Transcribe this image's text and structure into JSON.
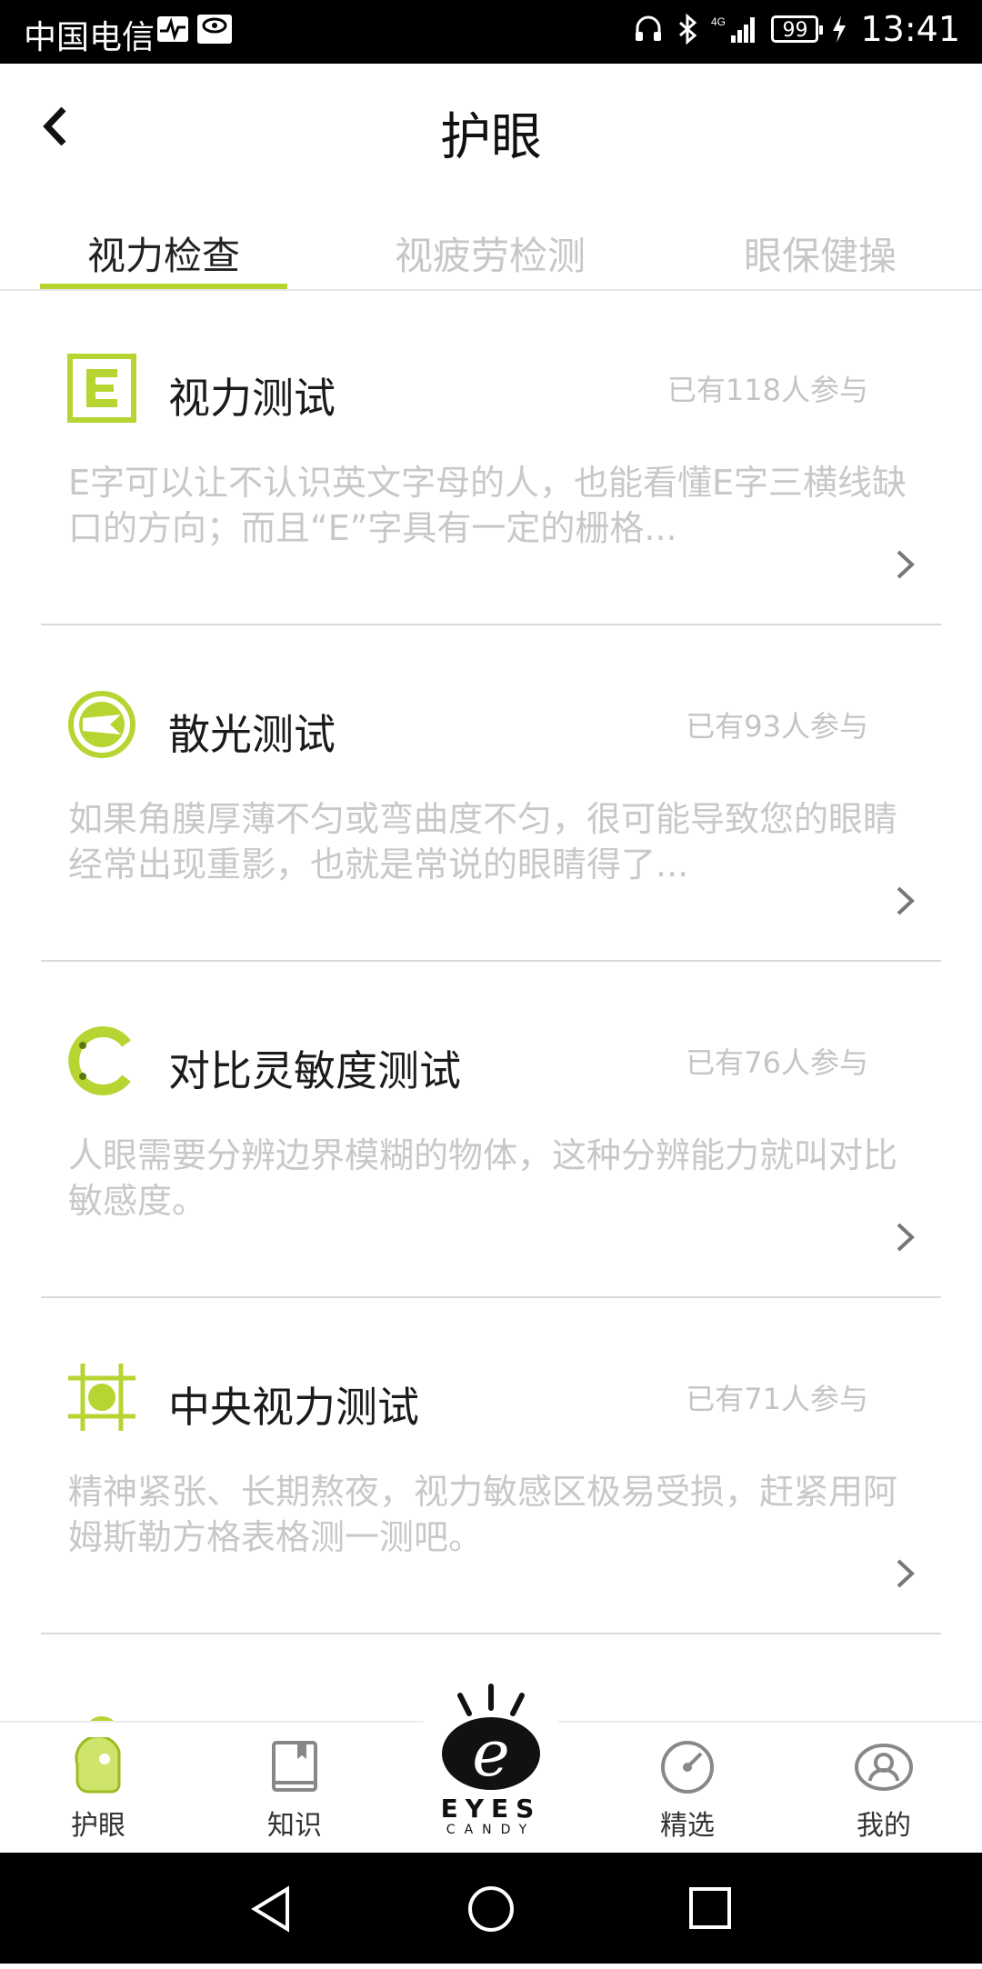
{
  "status_bar": {
    "carrier": "中国电信",
    "network": "4G",
    "battery": "99",
    "time": "13:41"
  },
  "header": {
    "title": "护眼"
  },
  "tabs": [
    {
      "label": "视力检查",
      "active": true
    },
    {
      "label": "视疲劳检测",
      "active": false
    },
    {
      "label": "眼保健操",
      "active": false
    }
  ],
  "tests": [
    {
      "icon": "e-chart-icon",
      "name": "视力测试",
      "count": "已有118人参与",
      "desc": "E字可以让不认识英文字母的人，也能看懂E字三横线缺口的方向；而且“E”字具有一定的栅格..."
    },
    {
      "icon": "astigmatism-icon",
      "name": "散光测试",
      "count": "已有93人参与",
      "desc": "如果角膜厚薄不匀或弯曲度不匀，很可能导致您的眼睛经常出现重影，也就是常说的眼睛得了..."
    },
    {
      "icon": "contrast-ring-icon",
      "name": "对比灵敏度测试",
      "count": "已有76人参与",
      "desc": "人眼需要分辨边界模糊的物体，这种分辨能力就叫对比敏感度。"
    },
    {
      "icon": "grid-icon",
      "name": "中央视力测试",
      "count": "已有71人参与",
      "desc": "精神紧张、长期熬夜，视力敏感区极易受损，赶紧用阿姆斯勒方格表格测一测吧。"
    }
  ],
  "bottom_nav": {
    "items": [
      {
        "label": "护眼",
        "icon": "eye-care-icon"
      },
      {
        "label": "知识",
        "icon": "book-icon"
      },
      {
        "label": "精选",
        "icon": "compass-icon"
      },
      {
        "label": "我的",
        "icon": "profile-icon"
      }
    ],
    "logo_text": "EYES",
    "logo_subtext": "CANDY"
  },
  "colors": {
    "accent": "#b7d532",
    "text_primary": "#1b1b1b",
    "text_muted": "#c8c8c8"
  }
}
